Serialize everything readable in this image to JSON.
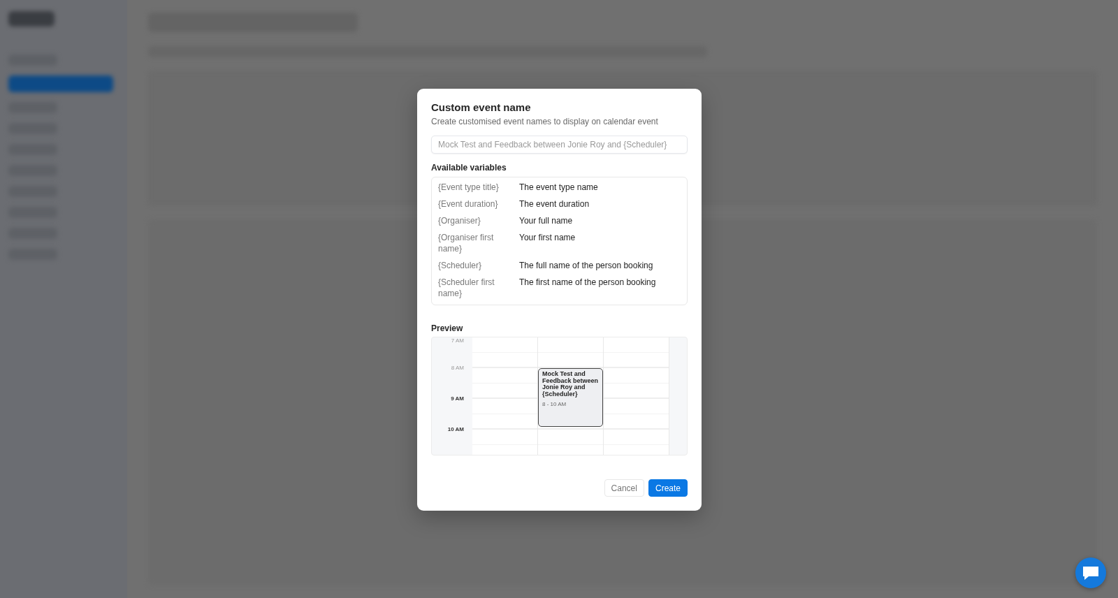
{
  "dialog": {
    "title": "Custom event name",
    "subtitle": "Create customised event names to display on calendar event",
    "name_field": {
      "placeholder": "Mock Test and Feedback between Jonie Roy and {Scheduler}"
    },
    "variables_heading": "Available variables",
    "variables": [
      {
        "variable": "{Event type title}",
        "description": "The event type name"
      },
      {
        "variable": "{Event duration}",
        "description": "The event duration"
      },
      {
        "variable": "{Organiser}",
        "description": "Your full name"
      },
      {
        "variable": "{Organiser first name}",
        "description": "Your first name"
      },
      {
        "variable": "{Scheduler}",
        "description": "The full name of the person booking"
      },
      {
        "variable": "{Scheduler first name}",
        "description": "The first name of the person booking"
      }
    ],
    "preview_heading": "Preview",
    "preview": {
      "hours": [
        {
          "label": "7 AM",
          "muted": true
        },
        {
          "label": "8 AM",
          "muted": true
        },
        {
          "label": "9 AM",
          "muted": false
        },
        {
          "label": "10 AM",
          "muted": false
        }
      ],
      "event": {
        "title": "Mock Test and Feedback between Jonie Roy and {Scheduler}",
        "time": "8 - 10 AM"
      }
    },
    "buttons": [
      {
        "label": "Cancel",
        "kind": "secondary"
      },
      {
        "label": "Create",
        "kind": "primary"
      }
    ]
  }
}
